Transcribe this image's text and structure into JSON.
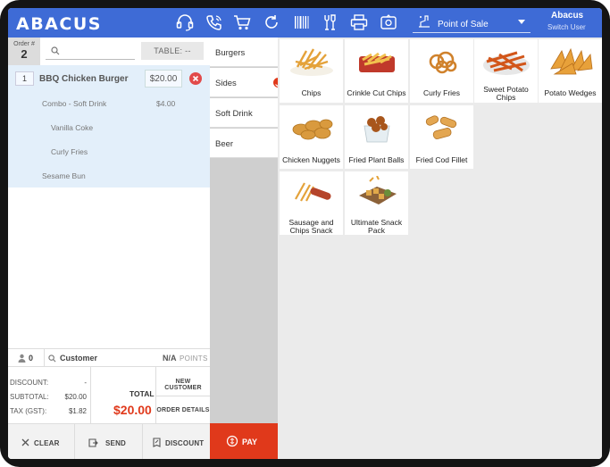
{
  "app": {
    "logo": "ABACUS",
    "mode_select": "Point of Sale",
    "user_name": "Abacus",
    "switch_user": "Switch User"
  },
  "header_icons": [
    "headset-icon",
    "phone-icon",
    "cart-icon",
    "refresh-icon",
    "barcode-icon",
    "cocktail-icon",
    "printer-icon",
    "cash-register-icon"
  ],
  "order": {
    "order_label": "Order #",
    "order_number": "2",
    "search_placeholder": "",
    "table": "TABLE: --",
    "line": {
      "qty": "1",
      "name": "BBQ Chicken Burger",
      "price": "$20.00",
      "modifiers": [
        {
          "name": "Combo - Soft Drink",
          "price": "$4.00"
        },
        {
          "name": "Vanilla Coke"
        },
        {
          "name": "Curly Fries"
        },
        {
          "name": "Sesame Bun"
        }
      ]
    },
    "customer_count": "0",
    "customer_label": "Customer",
    "points_value": "N/A",
    "points_label": "POINTS"
  },
  "totals": {
    "discount_label": "DISCOUNT:",
    "discount_value": "-",
    "subtotal_label": "SUBTOTAL:",
    "subtotal_value": "$20.00",
    "tax_label": "TAX (GST):",
    "tax_value": "$1.82",
    "total_label": "TOTAL",
    "total_value": "$20.00",
    "new_customer": "NEW CUSTOMER",
    "order_details": "ORDER DETAILS"
  },
  "actions": {
    "clear": "CLEAR",
    "send": "SEND",
    "discount": "DISCOUNT",
    "pay": "PAY"
  },
  "categories": [
    {
      "label": "Burgers",
      "selected": false
    },
    {
      "label": "Sides",
      "selected": true
    },
    {
      "label": "Soft Drink",
      "selected": false
    },
    {
      "label": "Beer",
      "selected": false
    }
  ],
  "products": [
    {
      "label": "Chips"
    },
    {
      "label": "Crinkle Cut Chips"
    },
    {
      "label": "Curly Fries"
    },
    {
      "label": "Sweet Potato Chips"
    },
    {
      "label": "Potato Wedges"
    },
    {
      "label": "Chicken Nuggets"
    },
    {
      "label": "Fried Plant Balls"
    },
    {
      "label": "Fried Cod Fillet"
    },
    {
      "label": "Sausage and Chips Snack"
    },
    {
      "label": "Ultimate Snack Pack"
    }
  ],
  "colors": {
    "header": "#3e6bd6",
    "accent_red": "#e0391b",
    "order_items_bg": "#e3effa"
  }
}
